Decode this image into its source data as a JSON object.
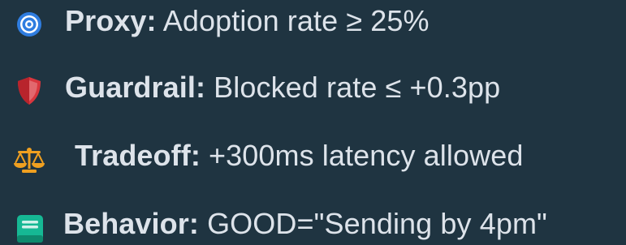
{
  "criteria": [
    {
      "icon": "target-icon",
      "label": "Proxy:",
      "value": "Adoption rate ≥ 25%",
      "accent": "#2f7de0"
    },
    {
      "icon": "shield-icon",
      "label": "Guardrail:",
      "value": "Blocked rate ≤ +0.3pp",
      "accent": "#d9363e"
    },
    {
      "icon": "balance-scale-icon",
      "label": "Tradeoff:",
      "value": "+300ms latency allowed",
      "accent": "#f0a020"
    },
    {
      "icon": "notebook-icon",
      "label": "Behavior:",
      "value": "GOOD=\"Sending by 4pm\"",
      "accent": "#16b894"
    }
  ]
}
